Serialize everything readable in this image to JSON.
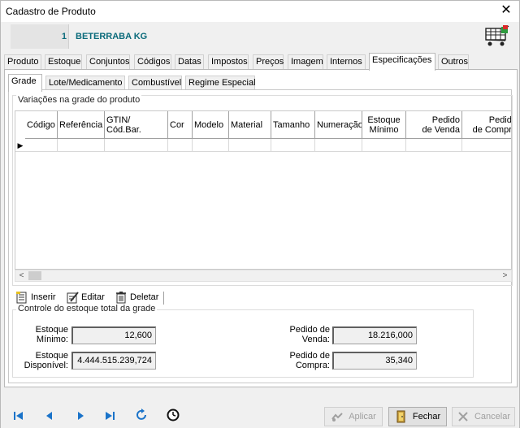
{
  "window": {
    "title": "Cadastro de Produto",
    "close_glyph": "✕"
  },
  "product": {
    "code": "1",
    "name": "BETERRABA KG",
    "icon": "shopping-cart-icon"
  },
  "main_tabs": [
    {
      "label": "Produto"
    },
    {
      "label": "Estoque"
    },
    {
      "label": "Conjuntos"
    },
    {
      "label": "Códigos"
    },
    {
      "label": "Datas"
    },
    {
      "label": "Impostos"
    },
    {
      "label": "Preços"
    },
    {
      "label": "Imagem"
    },
    {
      "label": "Internos"
    },
    {
      "label": "Especificações"
    },
    {
      "label": "Outros"
    }
  ],
  "main_tabs_active": "Especificações",
  "sub_tabs": [
    {
      "label": "Grade"
    },
    {
      "label": "Lote/Medicamento"
    },
    {
      "label": "Combustível"
    },
    {
      "label": "Regime Especial"
    }
  ],
  "sub_tabs_active": "Grade",
  "grade": {
    "legend": "Variações na grade do produto",
    "columns": [
      {
        "label": "Código"
      },
      {
        "label": "Referência"
      },
      {
        "label": "GTIN/\nCód.Bar."
      },
      {
        "label": "Cor"
      },
      {
        "label": "Modelo"
      },
      {
        "label": "Material"
      },
      {
        "label": "Tamanho"
      },
      {
        "label": "Numeração"
      },
      {
        "label": "Estoque\nMínimo"
      },
      {
        "label": "Pedido\nde Venda"
      },
      {
        "label": "Pedido\nde Compra"
      }
    ],
    "row_indicator": "▶",
    "scroll_left": "<",
    "scroll_right": ">"
  },
  "toolbar": {
    "insert": "Inserir",
    "edit": "Editar",
    "delete": "Deletar"
  },
  "controle": {
    "legend": "Controle do estoque total da grade",
    "estoque_minimo_label": "Estoque\nMínimo:",
    "estoque_minimo_value": "12,600",
    "estoque_disponivel_label": "Estoque\nDisponível:",
    "estoque_disponivel_value": "4.444.515.239,724",
    "pedido_venda_label": "Pedido de\nVenda:",
    "pedido_venda_value": "18.216,000",
    "pedido_compra_label": "Pedido de\nCompra:",
    "pedido_compra_value": "35,340"
  },
  "footer": {
    "aplicar": "Aplicar",
    "fechar": "Fechar",
    "cancelar": "Cancelar"
  },
  "colors": {
    "accent_teal": "#0b6b7b",
    "nav_blue": "#1a73c9",
    "window_bg": "#f0f0f0"
  }
}
